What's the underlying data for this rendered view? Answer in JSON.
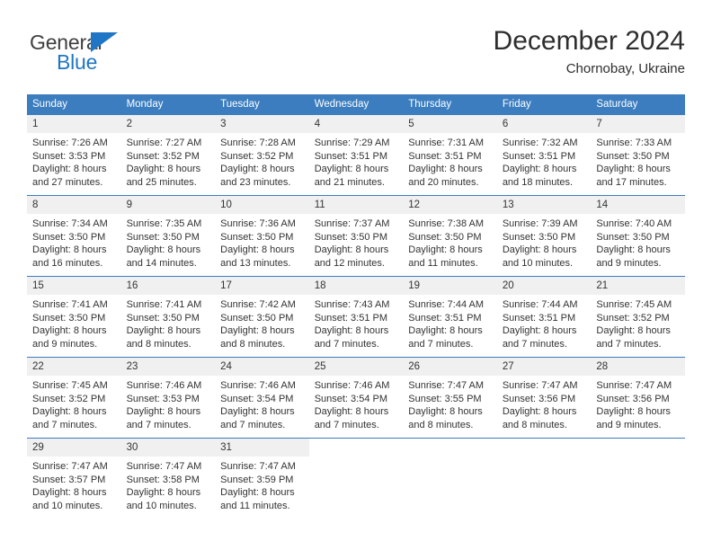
{
  "brand": {
    "name_dark": "General",
    "name_blue": "Blue",
    "triangle_color": "#1f76c4"
  },
  "header": {
    "title": "December 2024",
    "subtitle": "Chornobay, Ukraine"
  },
  "theme": {
    "header_bg": "#3b7dbf",
    "header_text": "#ffffff",
    "daynum_bg": "#f0f0f0",
    "body_text": "#333333"
  },
  "weekday_headers": [
    "Sunday",
    "Monday",
    "Tuesday",
    "Wednesday",
    "Thursday",
    "Friday",
    "Saturday"
  ],
  "weeks": [
    [
      {
        "day": "1",
        "sunrise": "Sunrise: 7:26 AM",
        "sunset": "Sunset: 3:53 PM",
        "daylight1": "Daylight: 8 hours",
        "daylight2": "and 27 minutes."
      },
      {
        "day": "2",
        "sunrise": "Sunrise: 7:27 AM",
        "sunset": "Sunset: 3:52 PM",
        "daylight1": "Daylight: 8 hours",
        "daylight2": "and 25 minutes."
      },
      {
        "day": "3",
        "sunrise": "Sunrise: 7:28 AM",
        "sunset": "Sunset: 3:52 PM",
        "daylight1": "Daylight: 8 hours",
        "daylight2": "and 23 minutes."
      },
      {
        "day": "4",
        "sunrise": "Sunrise: 7:29 AM",
        "sunset": "Sunset: 3:51 PM",
        "daylight1": "Daylight: 8 hours",
        "daylight2": "and 21 minutes."
      },
      {
        "day": "5",
        "sunrise": "Sunrise: 7:31 AM",
        "sunset": "Sunset: 3:51 PM",
        "daylight1": "Daylight: 8 hours",
        "daylight2": "and 20 minutes."
      },
      {
        "day": "6",
        "sunrise": "Sunrise: 7:32 AM",
        "sunset": "Sunset: 3:51 PM",
        "daylight1": "Daylight: 8 hours",
        "daylight2": "and 18 minutes."
      },
      {
        "day": "7",
        "sunrise": "Sunrise: 7:33 AM",
        "sunset": "Sunset: 3:50 PM",
        "daylight1": "Daylight: 8 hours",
        "daylight2": "and 17 minutes."
      }
    ],
    [
      {
        "day": "8",
        "sunrise": "Sunrise: 7:34 AM",
        "sunset": "Sunset: 3:50 PM",
        "daylight1": "Daylight: 8 hours",
        "daylight2": "and 16 minutes."
      },
      {
        "day": "9",
        "sunrise": "Sunrise: 7:35 AM",
        "sunset": "Sunset: 3:50 PM",
        "daylight1": "Daylight: 8 hours",
        "daylight2": "and 14 minutes."
      },
      {
        "day": "10",
        "sunrise": "Sunrise: 7:36 AM",
        "sunset": "Sunset: 3:50 PM",
        "daylight1": "Daylight: 8 hours",
        "daylight2": "and 13 minutes."
      },
      {
        "day": "11",
        "sunrise": "Sunrise: 7:37 AM",
        "sunset": "Sunset: 3:50 PM",
        "daylight1": "Daylight: 8 hours",
        "daylight2": "and 12 minutes."
      },
      {
        "day": "12",
        "sunrise": "Sunrise: 7:38 AM",
        "sunset": "Sunset: 3:50 PM",
        "daylight1": "Daylight: 8 hours",
        "daylight2": "and 11 minutes."
      },
      {
        "day": "13",
        "sunrise": "Sunrise: 7:39 AM",
        "sunset": "Sunset: 3:50 PM",
        "daylight1": "Daylight: 8 hours",
        "daylight2": "and 10 minutes."
      },
      {
        "day": "14",
        "sunrise": "Sunrise: 7:40 AM",
        "sunset": "Sunset: 3:50 PM",
        "daylight1": "Daylight: 8 hours",
        "daylight2": "and 9 minutes."
      }
    ],
    [
      {
        "day": "15",
        "sunrise": "Sunrise: 7:41 AM",
        "sunset": "Sunset: 3:50 PM",
        "daylight1": "Daylight: 8 hours",
        "daylight2": "and 9 minutes."
      },
      {
        "day": "16",
        "sunrise": "Sunrise: 7:41 AM",
        "sunset": "Sunset: 3:50 PM",
        "daylight1": "Daylight: 8 hours",
        "daylight2": "and 8 minutes."
      },
      {
        "day": "17",
        "sunrise": "Sunrise: 7:42 AM",
        "sunset": "Sunset: 3:50 PM",
        "daylight1": "Daylight: 8 hours",
        "daylight2": "and 8 minutes."
      },
      {
        "day": "18",
        "sunrise": "Sunrise: 7:43 AM",
        "sunset": "Sunset: 3:51 PM",
        "daylight1": "Daylight: 8 hours",
        "daylight2": "and 7 minutes."
      },
      {
        "day": "19",
        "sunrise": "Sunrise: 7:44 AM",
        "sunset": "Sunset: 3:51 PM",
        "daylight1": "Daylight: 8 hours",
        "daylight2": "and 7 minutes."
      },
      {
        "day": "20",
        "sunrise": "Sunrise: 7:44 AM",
        "sunset": "Sunset: 3:51 PM",
        "daylight1": "Daylight: 8 hours",
        "daylight2": "and 7 minutes."
      },
      {
        "day": "21",
        "sunrise": "Sunrise: 7:45 AM",
        "sunset": "Sunset: 3:52 PM",
        "daylight1": "Daylight: 8 hours",
        "daylight2": "and 7 minutes."
      }
    ],
    [
      {
        "day": "22",
        "sunrise": "Sunrise: 7:45 AM",
        "sunset": "Sunset: 3:52 PM",
        "daylight1": "Daylight: 8 hours",
        "daylight2": "and 7 minutes."
      },
      {
        "day": "23",
        "sunrise": "Sunrise: 7:46 AM",
        "sunset": "Sunset: 3:53 PM",
        "daylight1": "Daylight: 8 hours",
        "daylight2": "and 7 minutes."
      },
      {
        "day": "24",
        "sunrise": "Sunrise: 7:46 AM",
        "sunset": "Sunset: 3:54 PM",
        "daylight1": "Daylight: 8 hours",
        "daylight2": "and 7 minutes."
      },
      {
        "day": "25",
        "sunrise": "Sunrise: 7:46 AM",
        "sunset": "Sunset: 3:54 PM",
        "daylight1": "Daylight: 8 hours",
        "daylight2": "and 7 minutes."
      },
      {
        "day": "26",
        "sunrise": "Sunrise: 7:47 AM",
        "sunset": "Sunset: 3:55 PM",
        "daylight1": "Daylight: 8 hours",
        "daylight2": "and 8 minutes."
      },
      {
        "day": "27",
        "sunrise": "Sunrise: 7:47 AM",
        "sunset": "Sunset: 3:56 PM",
        "daylight1": "Daylight: 8 hours",
        "daylight2": "and 8 minutes."
      },
      {
        "day": "28",
        "sunrise": "Sunrise: 7:47 AM",
        "sunset": "Sunset: 3:56 PM",
        "daylight1": "Daylight: 8 hours",
        "daylight2": "and 9 minutes."
      }
    ],
    [
      {
        "day": "29",
        "sunrise": "Sunrise: 7:47 AM",
        "sunset": "Sunset: 3:57 PM",
        "daylight1": "Daylight: 8 hours",
        "daylight2": "and 10 minutes."
      },
      {
        "day": "30",
        "sunrise": "Sunrise: 7:47 AM",
        "sunset": "Sunset: 3:58 PM",
        "daylight1": "Daylight: 8 hours",
        "daylight2": "and 10 minutes."
      },
      {
        "day": "31",
        "sunrise": "Sunrise: 7:47 AM",
        "sunset": "Sunset: 3:59 PM",
        "daylight1": "Daylight: 8 hours",
        "daylight2": "and 11 minutes."
      },
      {
        "day": "",
        "sunrise": "",
        "sunset": "",
        "daylight1": "",
        "daylight2": ""
      },
      {
        "day": "",
        "sunrise": "",
        "sunset": "",
        "daylight1": "",
        "daylight2": ""
      },
      {
        "day": "",
        "sunrise": "",
        "sunset": "",
        "daylight1": "",
        "daylight2": ""
      },
      {
        "day": "",
        "sunrise": "",
        "sunset": "",
        "daylight1": "",
        "daylight2": ""
      }
    ]
  ]
}
